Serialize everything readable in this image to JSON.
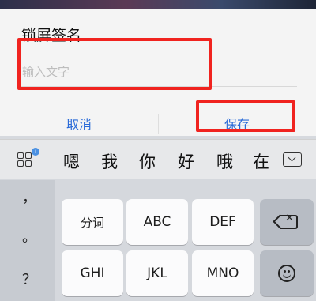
{
  "dialog": {
    "title": "锁屏签名",
    "input_placeholder": "输入文字",
    "cancel_label": "取消",
    "save_label": "保存"
  },
  "keyboard": {
    "candidates": [
      "嗯",
      "我",
      "你",
      "好",
      "哦",
      "在"
    ],
    "menu_badge": "i",
    "punctuation": [
      "，",
      "。",
      "？"
    ],
    "row1": [
      "分词",
      "ABC",
      "DEF"
    ],
    "row2": [
      "GHI",
      "JKL",
      "MNO"
    ]
  },
  "colors": {
    "accent": "#2a6bd8",
    "annotation": "#f0231f"
  },
  "icons": [
    "keyboard-menu-icon",
    "collapse-keyboard-icon",
    "backspace-icon",
    "emoji-icon"
  ]
}
